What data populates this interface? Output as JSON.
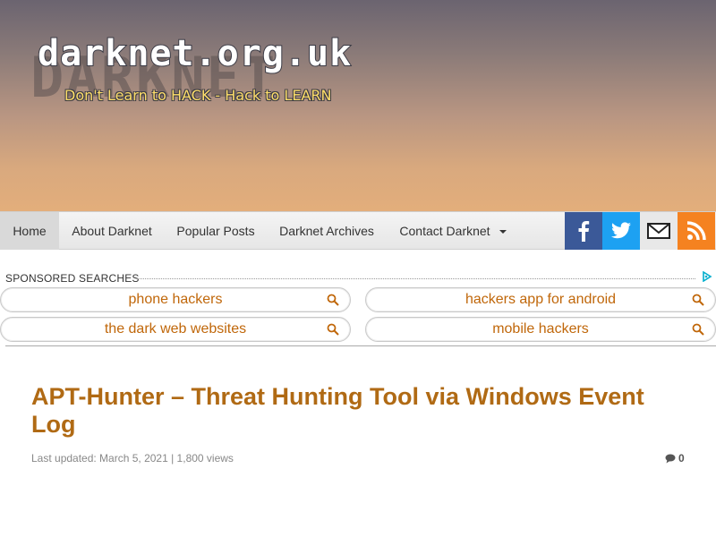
{
  "site": {
    "logo": "darknet.org.uk",
    "logo_shadow": "DARKNET",
    "tagline": "Don't Learn to HACK - Hack to LEARN"
  },
  "nav": {
    "items": [
      {
        "label": "Home",
        "active": true
      },
      {
        "label": "About Darknet"
      },
      {
        "label": "Popular Posts"
      },
      {
        "label": "Darknet Archives"
      },
      {
        "label": "Contact Darknet",
        "dropdown": true
      }
    ],
    "social": [
      {
        "icon": "facebook-icon",
        "color": "#3b5998"
      },
      {
        "icon": "twitter-icon",
        "color": "#1da1f2"
      },
      {
        "icon": "email-icon",
        "color": "#e8e8e8"
      },
      {
        "icon": "rss-icon",
        "color": "#f58220"
      }
    ]
  },
  "sponsored": {
    "label": "SPONSORED SEARCHES",
    "searches": [
      "phone hackers",
      "hackers app for android",
      "the dark web websites",
      "mobile hackers"
    ]
  },
  "article": {
    "title": "APT-Hunter – Threat Hunting Tool via Windows Event Log",
    "meta": "Last updated: March 5, 2021 | 1,800 views",
    "comment_count": "0"
  },
  "colors": {
    "accent": "#b06a14",
    "search_text": "#c0670a"
  }
}
